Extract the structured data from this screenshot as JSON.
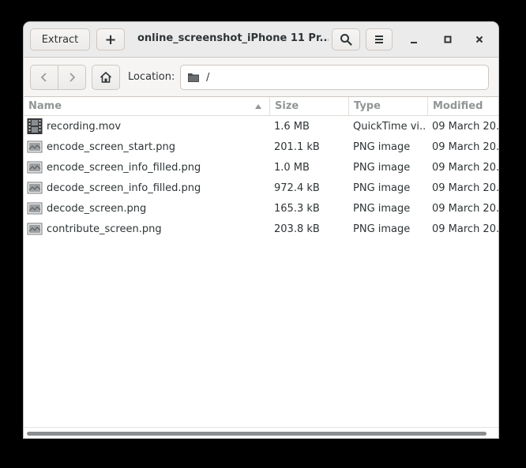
{
  "headerbar": {
    "extract_label": "Extract",
    "add_label": "+",
    "title": "online_screenshot_iPhone 11 Pr..."
  },
  "toolbar": {
    "location_label": "Location:",
    "location_value": "/"
  },
  "columns": {
    "name": "Name",
    "size": "Size",
    "type": "Type",
    "modified": "Modified"
  },
  "files": [
    {
      "name": "recording.mov",
      "size": "1.6 MB",
      "type": "QuickTime vi...",
      "modified": "09 March 20...",
      "icon": "video-file-icon"
    },
    {
      "name": "encode_screen_start.png",
      "size": "201.1 kB",
      "type": "PNG image",
      "modified": "09 March 20...",
      "icon": "image-file-icon"
    },
    {
      "name": "encode_screen_info_filled.png",
      "size": "1.0 MB",
      "type": "PNG image",
      "modified": "09 March 20...",
      "icon": "image-file-icon"
    },
    {
      "name": "decode_screen_info_filled.png",
      "size": "972.4 kB",
      "type": "PNG image",
      "modified": "09 March 20...",
      "icon": "image-file-icon"
    },
    {
      "name": "decode_screen.png",
      "size": "165.3 kB",
      "type": "PNG image",
      "modified": "09 March 20...",
      "icon": "image-file-icon"
    },
    {
      "name": "contribute_screen.png",
      "size": "203.8 kB",
      "type": "PNG image",
      "modified": "09 March 20...",
      "icon": "image-file-icon"
    }
  ],
  "colors": {
    "accent": "#2e3436",
    "header_bg": "#ebebeb",
    "column_header_text": "#929595"
  }
}
